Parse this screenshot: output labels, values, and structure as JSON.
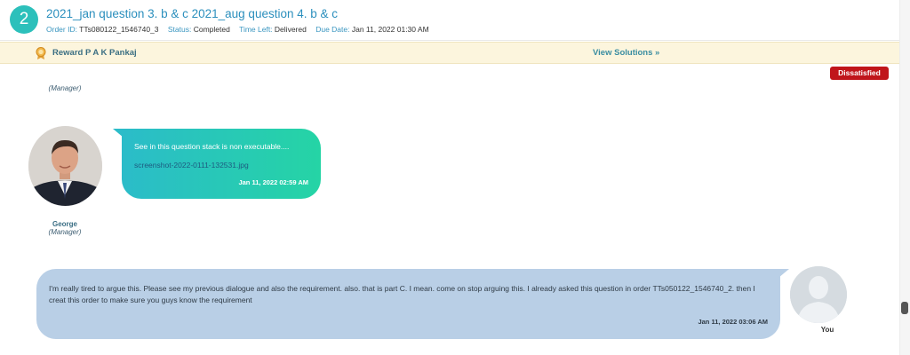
{
  "order": {
    "step_number": "2",
    "title": "2021_jan question 3. b & c 2021_aug question 4. b & c",
    "order_id_label": "Order ID:",
    "order_id": "TTs080122_1546740_3",
    "status_label": "Status:",
    "status": "Completed",
    "time_left_label": "Time Left:",
    "time_left": "Delivered",
    "due_date_label": "Due Date:",
    "due_date": "Jan 11, 2022 01:30 AM"
  },
  "reward_bar": {
    "icon": "medal-icon",
    "reward_text": "Reward P A K Pankaj",
    "view_solutions_label": "View Solutions »"
  },
  "status_badge": "Dissatisfied",
  "chat": {
    "top_role": "(Manager)",
    "messages": [
      {
        "sender": "George",
        "role": "(Manager)",
        "text": "See in this question stack is non executable....",
        "attachment": "screenshot-2022-0111-132531.jpg",
        "time": "Jan 11, 2022 02:59 AM"
      },
      {
        "sender": "You",
        "text": "I'm really tired to argue this. Please see my previous dialogue and also the requirement. also. that is part C. I mean. come on stop arguing this. I already asked this question in order TTs050122_1546740_2. then I creat this order to make sure you guys know the requirement",
        "time": "Jan 11, 2022 03:06 AM"
      }
    ]
  },
  "colors": {
    "accent": "#2cc0bb",
    "link": "#2b8fbd",
    "badge": "#c0151b",
    "incoming_bubble_start": "#2bbcc9",
    "incoming_bubble_end": "#25d4a5",
    "outgoing_bubble": "#b9cfe6",
    "reward_bg": "#fcf5dd"
  }
}
